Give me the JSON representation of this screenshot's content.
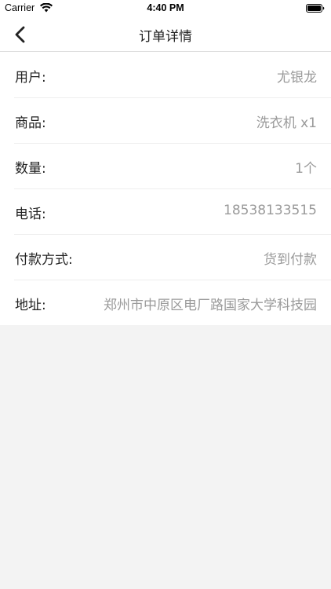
{
  "status_bar": {
    "carrier": "Carrier",
    "time": "4:40 PM"
  },
  "nav": {
    "title": "订单详情",
    "back_icon": "chevron-left-icon"
  },
  "order": {
    "rows": [
      {
        "label": "用户:",
        "value": "尤银龙"
      },
      {
        "label": "商品:",
        "value": "洗衣机 x1"
      },
      {
        "label": "数量:",
        "value": "1个"
      },
      {
        "label": "电话:",
        "value": "18538133515"
      },
      {
        "label": "付款方式:",
        "value": "货到付款"
      },
      {
        "label": "地址:",
        "value": "郑州市中原区电厂路国家大学科技园"
      }
    ]
  }
}
